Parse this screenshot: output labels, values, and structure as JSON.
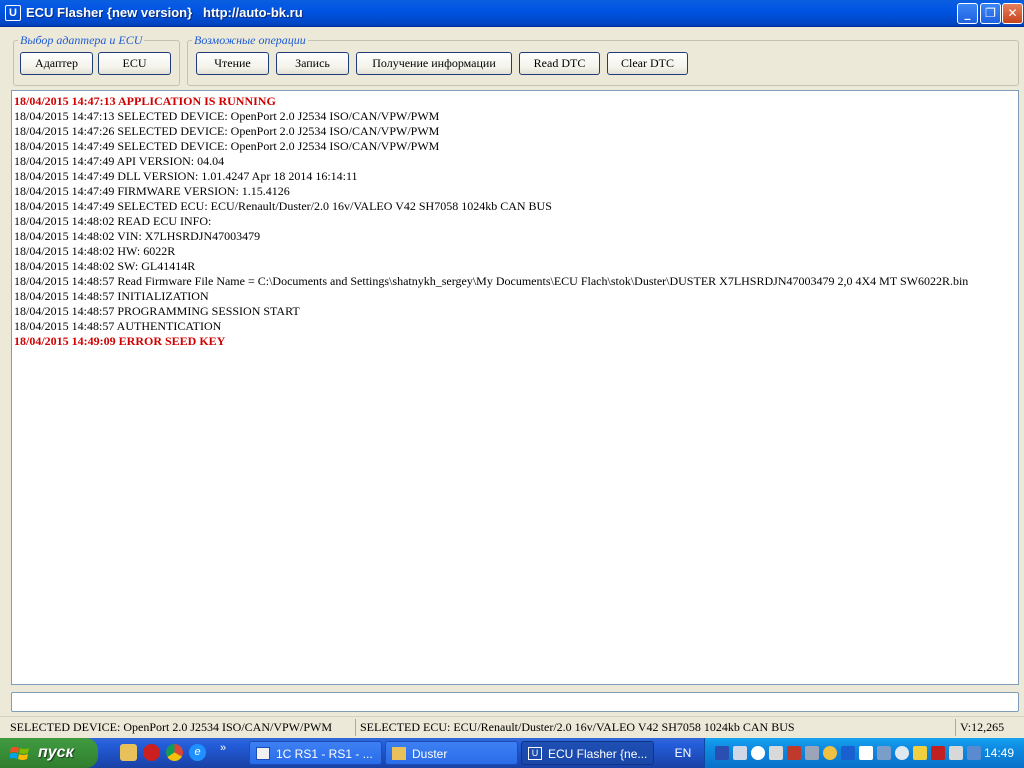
{
  "window": {
    "title": "ECU Flasher {new version}   http://auto-bk.ru",
    "icon": "app-icon",
    "controls": {
      "minimize": "_",
      "maximize": "❐",
      "close": "✕"
    }
  },
  "groups": {
    "adapter": {
      "label": "Выбор адаптера и ECU",
      "buttons": [
        "Адаптер",
        "ECU"
      ]
    },
    "operations": {
      "label": "Возможные операции",
      "buttons": [
        "Чтение",
        "Запись",
        "Получение информации",
        "Read DTC",
        "Clear DTC"
      ]
    }
  },
  "log": {
    "lines": [
      {
        "text": "18/04/2015 14:47:13 APPLICATION IS RUNNING",
        "error": true
      },
      {
        "text": "18/04/2015 14:47:13 SELECTED DEVICE: OpenPort 2.0 J2534 ISO/CAN/VPW/PWM",
        "error": false
      },
      {
        "text": "18/04/2015 14:47:26 SELECTED DEVICE: OpenPort 2.0 J2534 ISO/CAN/VPW/PWM",
        "error": false
      },
      {
        "text": "18/04/2015 14:47:49 SELECTED DEVICE: OpenPort 2.0 J2534 ISO/CAN/VPW/PWM",
        "error": false
      },
      {
        "text": "18/04/2015 14:47:49 API VERSION: 04.04",
        "error": false
      },
      {
        "text": "18/04/2015 14:47:49 DLL VERSION: 1.01.4247 Apr 18 2014 16:14:11",
        "error": false
      },
      {
        "text": "18/04/2015 14:47:49 FIRMWARE VERSION: 1.15.4126",
        "error": false
      },
      {
        "text": "18/04/2015 14:47:49 SELECTED ECU: ECU/Renault/Duster/2.0 16v/VALEO V42 SH7058 1024kb CAN BUS",
        "error": false
      },
      {
        "text": "18/04/2015 14:48:02 READ ECU INFO:",
        "error": false
      },
      {
        "text": "18/04/2015 14:48:02 VIN: X7LHSRDJN47003479",
        "error": false
      },
      {
        "text": "18/04/2015 14:48:02 HW: 6022R",
        "error": false
      },
      {
        "text": "18/04/2015 14:48:02 SW: GL41414R",
        "error": false
      },
      {
        "text": "18/04/2015 14:48:57 Read Firmware File Name = C:\\Documents and Settings\\shatnykh_sergey\\My Documents\\ECU Flach\\stok\\Duster\\DUSTER X7LHSRDJN47003479 2,0 4X4 MT SW6022R.bin",
        "error": false
      },
      {
        "text": "18/04/2015 14:48:57 INITIALIZATION",
        "error": false
      },
      {
        "text": "18/04/2015 14:48:57 PROGRAMMING SESSION START",
        "error": false
      },
      {
        "text": "18/04/2015 14:48:57 AUTHENTICATION",
        "error": false
      },
      {
        "text": "18/04/2015 14:49:09 ERROR SEED KEY",
        "error": true
      }
    ]
  },
  "input": {
    "value": ""
  },
  "statusbar": {
    "device": "SELECTED DEVICE: OpenPort 2.0 J2534 ISO/CAN/VPW/PWM",
    "ecu": "SELECTED ECU: ECU/Renault/Duster/2.0 16v/VALEO V42 SH7058 1024kb CAN BUS",
    "version": "V:12,265"
  },
  "taskbar": {
    "start_label": "пуск",
    "quick_launch": [
      "folder-icon",
      "opera-icon",
      "chrome-icon",
      "ie-icon"
    ],
    "more": "»",
    "tasks": [
      {
        "label": "1C RS1 - RS1 - ...",
        "icon": "1c-icon",
        "active": false
      },
      {
        "label": "Duster",
        "icon": "folder-icon",
        "active": false
      },
      {
        "label": "ECU Flasher {ne...",
        "icon": "app-icon",
        "active": true
      }
    ],
    "language": "EN",
    "clock": "14:49"
  },
  "colors": {
    "error_text": "#d00000",
    "group_label": "#1e5bd5",
    "titlebar": "#0054e3",
    "start": "#388e38"
  }
}
